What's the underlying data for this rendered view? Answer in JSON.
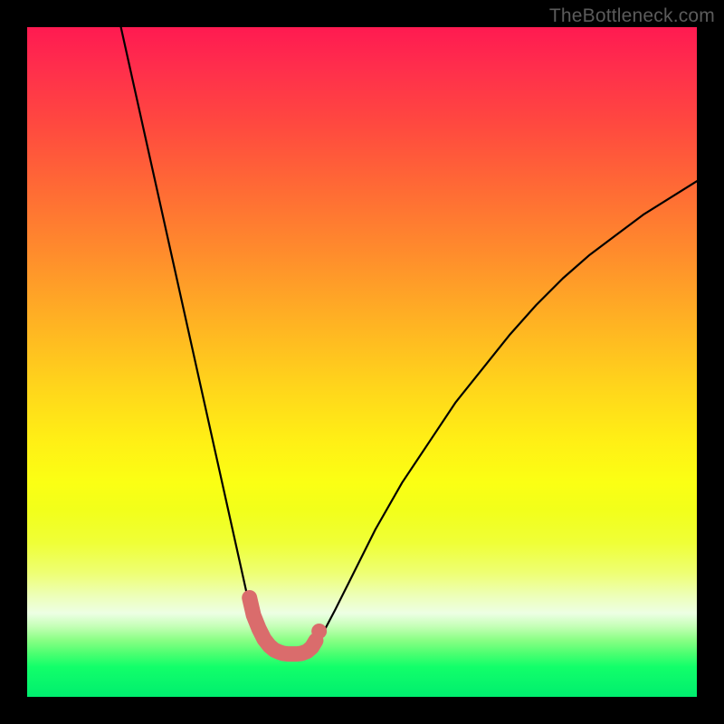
{
  "watermark": "TheBottleneck.com",
  "colors": {
    "background": "#000000",
    "gradient_top": "#ff1a51",
    "gradient_mid": "#ffd61b",
    "gradient_bottom": "#00ee6e",
    "curve_stroke": "#000000",
    "marker_fill": "#da6c6c"
  },
  "chart_data": {
    "type": "line",
    "title": "",
    "xlabel": "",
    "ylabel": "",
    "xlim": [
      0,
      100
    ],
    "ylim": [
      0,
      100
    ],
    "grid": false,
    "legend": false,
    "series": [
      {
        "name": "left-branch",
        "x": [
          14,
          16,
          18,
          20,
          22,
          24,
          26,
          28,
          30,
          32,
          33,
          34,
          35,
          36
        ],
        "y": [
          100,
          91,
          82,
          73,
          64,
          55,
          46,
          37,
          28,
          19,
          14.5,
          10.5,
          8.2,
          6.8
        ]
      },
      {
        "name": "right-branch",
        "x": [
          42,
          44,
          46,
          48,
          52,
          56,
          60,
          64,
          68,
          72,
          76,
          80,
          84,
          88,
          92,
          96,
          100
        ],
        "y": [
          6.8,
          9.2,
          13,
          17,
          25,
          32,
          38,
          44,
          49,
          54,
          58.5,
          62.5,
          66,
          69,
          72,
          74.5,
          77
        ]
      },
      {
        "name": "floor",
        "x": [
          36,
          38,
          40,
          42
        ],
        "y": [
          6.8,
          6.4,
          6.4,
          6.8
        ]
      }
    ],
    "markers": {
      "name": "highlight-points",
      "x": [
        33.2,
        33.8,
        34.6,
        35.4,
        36.2,
        36.9,
        37.6,
        38.2,
        38.9,
        39.6,
        40.3,
        41.0,
        41.8,
        42.5,
        43.1,
        43.6
      ],
      "y": [
        14.8,
        12.2,
        10.2,
        8.6,
        7.6,
        7.0,
        6.7,
        6.5,
        6.4,
        6.4,
        6.4,
        6.5,
        6.8,
        7.4,
        8.4,
        9.8
      ]
    }
  }
}
